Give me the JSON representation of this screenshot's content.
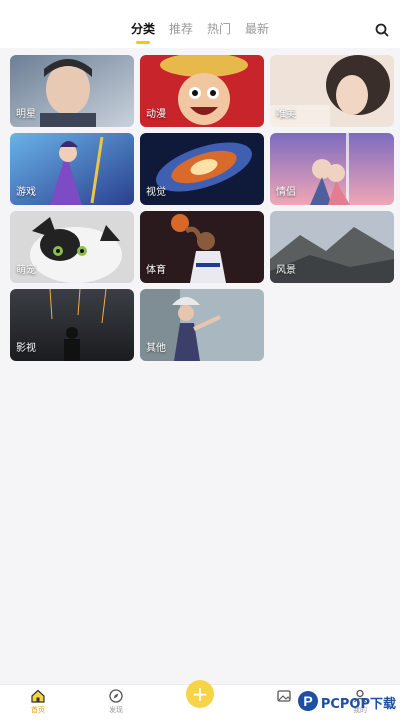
{
  "header": {
    "tabs": [
      {
        "label": "分类",
        "active": true
      },
      {
        "label": "推荐",
        "active": false
      },
      {
        "label": "热门",
        "active": false
      },
      {
        "label": "最新",
        "active": false
      }
    ],
    "search_icon": "search-icon"
  },
  "categories": [
    {
      "label": "明星"
    },
    {
      "label": "动漫"
    },
    {
      "label": "唯美"
    },
    {
      "label": "游戏"
    },
    {
      "label": "视觉"
    },
    {
      "label": "情侣"
    },
    {
      "label": "萌宠"
    },
    {
      "label": "体育"
    },
    {
      "label": "风景"
    },
    {
      "label": "影视"
    },
    {
      "label": "其他"
    }
  ],
  "bottom_nav": {
    "items": [
      {
        "label": "首页",
        "icon": "home-icon",
        "active": true
      },
      {
        "label": "发现",
        "icon": "compass-icon",
        "active": false
      },
      {
        "label": "",
        "icon": "plus-icon",
        "active": false
      },
      {
        "label": "",
        "icon": "image-icon",
        "active": false
      },
      {
        "label": "我的",
        "icon": "user-icon",
        "active": false
      }
    ]
  },
  "watermark": {
    "text": "PCPOP下载"
  },
  "colors": {
    "accent": "#f5c518",
    "fab": "#f7d447",
    "background": "#f5f5f7"
  }
}
